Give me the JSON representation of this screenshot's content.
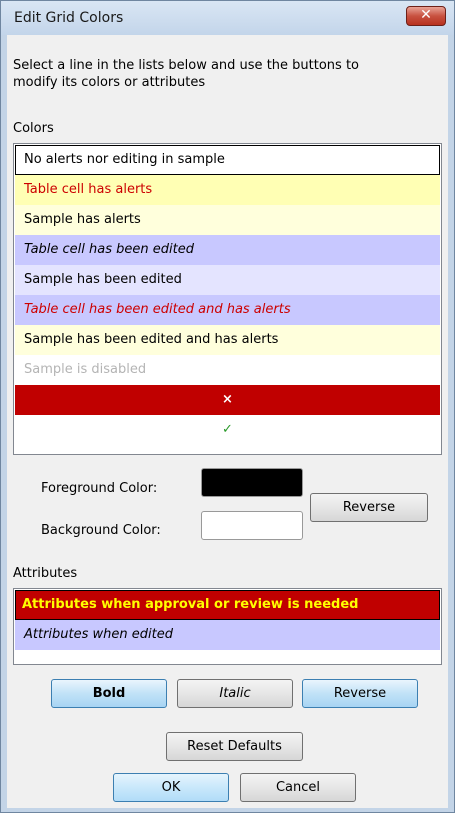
{
  "window": {
    "title": "Edit Grid Colors",
    "close_glyph": "✕"
  },
  "description": "Select a line in the lists below and use the buttons to modify its colors or attributes",
  "colors_section": {
    "label": "Colors",
    "items": [
      {
        "text": "No alerts nor editing in sample",
        "bg": "#ffffff",
        "fg": "#000000"
      },
      {
        "text": "Table cell has alerts",
        "bg": "#ffffb4",
        "fg": "#cc0000"
      },
      {
        "text": "Sample has alerts",
        "bg": "#ffffdc",
        "fg": "#000000"
      },
      {
        "text": "Table cell has been edited",
        "bg": "#c8c8ff",
        "fg": "#000000"
      },
      {
        "text": "Sample has been edited",
        "bg": "#e4e4ff",
        "fg": "#000000"
      },
      {
        "text": "Table cell has been edited and has alerts",
        "bg": "#c8c8ff",
        "fg": "#cc0000"
      },
      {
        "text": "Sample has been edited and has alerts",
        "bg": "#ffffdc",
        "fg": "#000000"
      },
      {
        "text": "Sample is disabled",
        "bg": "#ffffff",
        "fg": "#b4b4b4"
      },
      {
        "text": "×",
        "bg": "#c00000",
        "fg": "#ffffff"
      },
      {
        "text": "✓",
        "bg": "#ffffff",
        "fg": "#2a9a2a"
      }
    ]
  },
  "foreground": {
    "label": "Foreground Color:",
    "color": "#000000"
  },
  "background": {
    "label": "Background Color:",
    "color": "#ffffff"
  },
  "reverse_colors_label": "Reverse",
  "attributes_section": {
    "label": "Attributes",
    "items": [
      {
        "text": "Attributes when approval or review is needed",
        "bg": "#c00000",
        "fg": "#ffff00"
      },
      {
        "text": "Attributes when edited",
        "bg": "#c8c8ff",
        "fg": "#000000"
      }
    ]
  },
  "style_buttons": {
    "bold": "Bold",
    "italic": "Italic",
    "reverse": "Reverse"
  },
  "reset_label": "Reset Defaults",
  "ok_label": "OK",
  "cancel_label": "Cancel"
}
